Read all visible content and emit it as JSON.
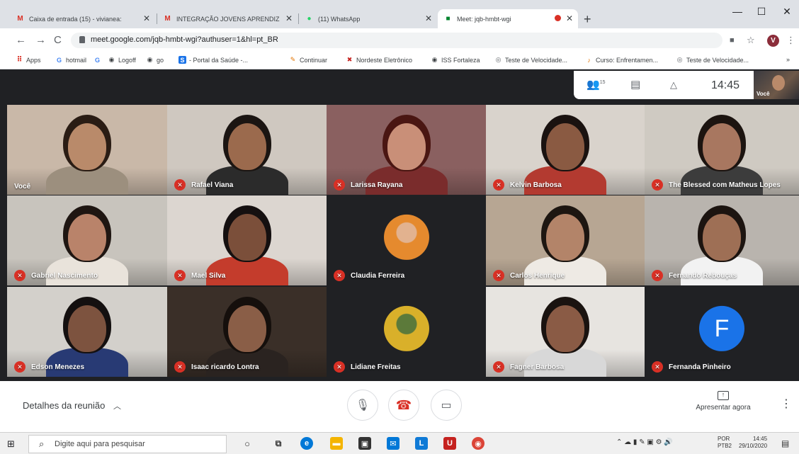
{
  "browser": {
    "tabs": [
      {
        "title": "Caixa de entrada (15) - vivianea:",
        "favicon": "gmail-icon",
        "fav_text": "M",
        "fav_color": "#d93025"
      },
      {
        "title": "INTEGRAÇÃO JOVENS APRENDIZ",
        "favicon": "gmail-icon",
        "fav_text": "M",
        "fav_color": "#d93025"
      },
      {
        "title": "(11) WhatsApp",
        "favicon": "whatsapp-icon",
        "fav_text": "●",
        "fav_color": "#25d366"
      },
      {
        "title": "Meet: jqb-hmbt-wgi",
        "favicon": "meet-icon",
        "fav_text": "■",
        "fav_color": "#00832d",
        "active": true
      }
    ],
    "new_tab": "+",
    "window_controls": {
      "minimize": "—",
      "maximize": "☐",
      "close": "✕"
    },
    "nav": {
      "back": "←",
      "forward": "→",
      "reload": "C"
    },
    "url": "meet.google.com/jqb-hmbt-wgi?authuser=1&hl=pt_BR",
    "profile_initial": "V",
    "bookmarks": [
      {
        "label": "Apps",
        "icon": "apps-icon",
        "color": "#5f6368"
      },
      {
        "label": "hotmail",
        "icon": "google-icon",
        "color": "#4285f4"
      },
      {
        "label": "",
        "icon": "google-icon",
        "color": "#4285f4"
      },
      {
        "label": "Logoff",
        "icon": "globe-icon",
        "color": "#3c4043"
      },
      {
        "label": "go",
        "icon": "globe-icon",
        "color": "#3c4043"
      },
      {
        "label": "- Portal da Saúde -...",
        "icon": "s-icon",
        "color": "#1a73e8"
      },
      {
        "label": "Continuar",
        "icon": "continue-icon",
        "color": "#e37400"
      },
      {
        "label": "Nordeste Eletrônico",
        "icon": "nordeste-icon",
        "color": "#c5221f"
      },
      {
        "label": "ISS Fortaleza",
        "icon": "globe-icon",
        "color": "#3c4043"
      },
      {
        "label": "Teste de Velocidade...",
        "icon": "speed-icon",
        "color": "#5f6368"
      },
      {
        "label": "Curso: Enfrentamen...",
        "icon": "course-icon",
        "color": "#e37400"
      },
      {
        "label": "Teste de Velocidade...",
        "icon": "speed-icon",
        "color": "#5f6368"
      }
    ],
    "bookmark_overflow": "»"
  },
  "meet": {
    "participants_count": "15",
    "time": "14:45",
    "self_label": "Você",
    "tiles": [
      {
        "name": "Você",
        "muted": false,
        "bg": "#c9b8a8",
        "skin": "#b98a6a",
        "hair": "#2a1c14",
        "shirt": "#9c8f7e"
      },
      {
        "name": "Rafael Viana",
        "muted": true,
        "bg": "#cfc8c0",
        "skin": "#9b6a4d",
        "hair": "#1b1512",
        "shirt": "#2b2b2b"
      },
      {
        "name": "Larissa Rayana",
        "muted": true,
        "bg": "#8a6060",
        "skin": "#c98f78",
        "hair": "#4a1612",
        "shirt": "#7a2c2c"
      },
      {
        "name": "Kelvin Barbosa",
        "muted": true,
        "bg": "#d9d3cc",
        "skin": "#8a5a42",
        "hair": "#1a1210",
        "shirt": "#b33a30"
      },
      {
        "name": "The Blessed com Matheus Lopes",
        "muted": true,
        "bg": "#cfcac2",
        "skin": "#a87760",
        "hair": "#1c1410",
        "shirt": "#3c3c3c"
      },
      {
        "name": "Gabriel Nascimento",
        "muted": true,
        "bg": "#c8c4bd",
        "skin": "#b9836a",
        "hair": "#1f1612",
        "shirt": "#e9e3db"
      },
      {
        "name": "Mael Silva",
        "muted": true,
        "bg": "#dcd6d0",
        "skin": "#7b4f3a",
        "hair": "#151010",
        "shirt": "#c43c2c"
      },
      {
        "name": "Claudia Ferreira",
        "muted": true,
        "bg": "#202124",
        "avatar": "#e58a2e",
        "avatar_skin": "#e2b28f"
      },
      {
        "name": "Carlos Henrique",
        "muted": true,
        "bg": "#b7a693",
        "skin": "#b38469",
        "hair": "#1d1611",
        "shirt": "#eeeae4"
      },
      {
        "name": "Fernando Rebouças",
        "muted": true,
        "bg": "#b9b4ae",
        "skin": "#9e6f55",
        "hair": "#1c1410",
        "shirt": "#f2f2f2"
      },
      {
        "name": "Edson Menezes",
        "muted": true,
        "bg": "#d3d0cb",
        "skin": "#7d533f",
        "hair": "#141010",
        "shirt": "#283a74"
      },
      {
        "name": "Isaac ricardo Lontra",
        "muted": true,
        "bg": "#3a2f28",
        "skin": "#8a5e47",
        "hair": "#150f0c",
        "shirt": "#2a2320"
      },
      {
        "name": "Lidiane Freitas",
        "muted": true,
        "bg": "#202124",
        "avatar": "#d9b02a",
        "avatar_skin": "#5c7a3a"
      },
      {
        "name": "Fagner Barbosa",
        "muted": true,
        "bg": "#e7e4e0",
        "skin": "#8a5b45",
        "hair": "#1a1310",
        "shirt": "#d8d8d8"
      },
      {
        "name": "Fernanda Pinheiro",
        "muted": true,
        "bg": "#202124",
        "letter": "F",
        "letter_bg": "#1a73e8"
      }
    ],
    "bottom": {
      "details": "Detalhes da reunião",
      "present": "Apresentar agora"
    }
  },
  "taskbar": {
    "search_placeholder": "Digite aqui para pesquisar",
    "lang_line1": "POR",
    "lang_line2": "PTB2",
    "time": "14:45",
    "date": "29/10/2020"
  }
}
